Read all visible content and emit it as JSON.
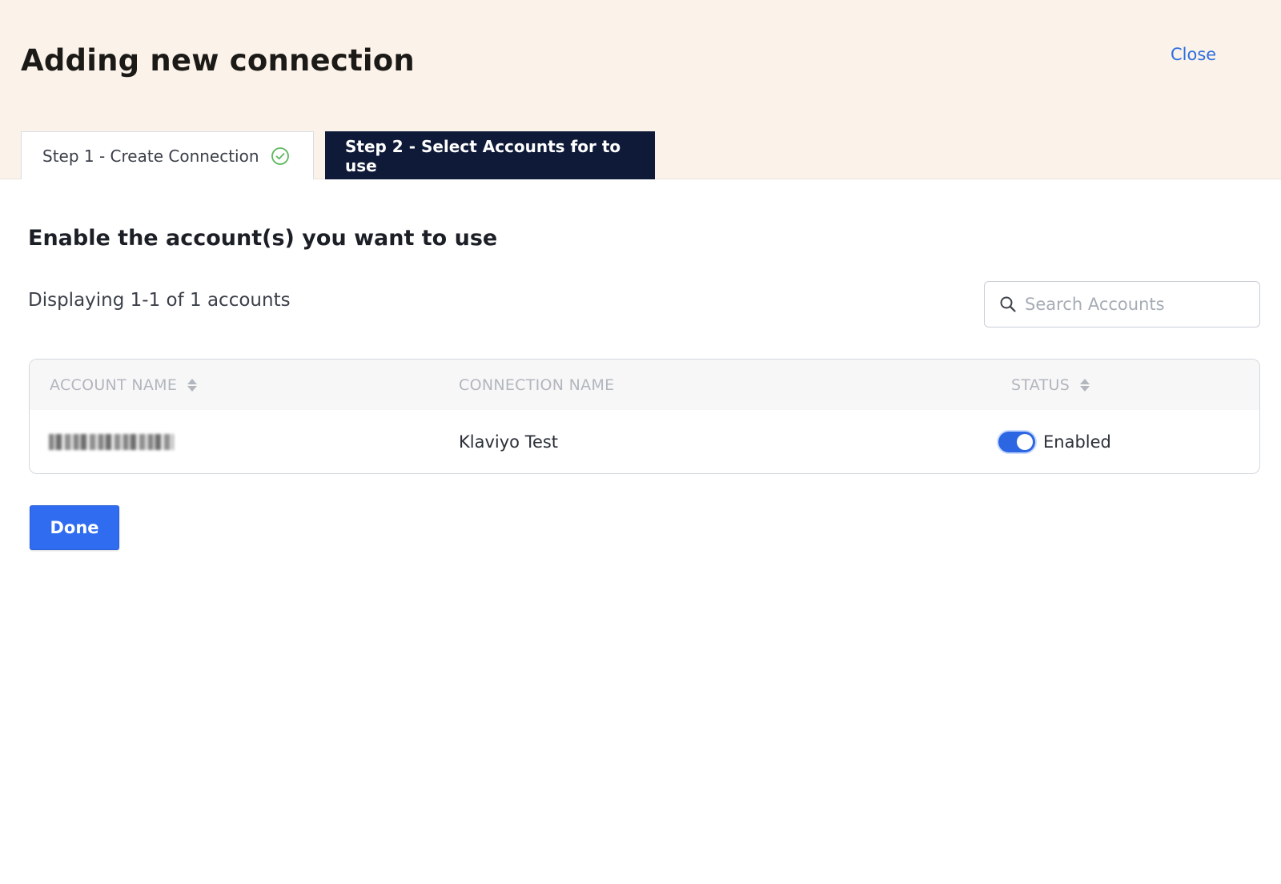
{
  "header": {
    "title": "Adding new connection",
    "close_label": "Close"
  },
  "steps": [
    {
      "label": "Step 1 - Create Connection",
      "completed": true
    },
    {
      "label": "Step 2 - Select Accounts for to use",
      "active": true
    }
  ],
  "main": {
    "heading": "Enable the account(s) you want to use",
    "display_count": "Displaying 1-1 of 1 accounts",
    "search": {
      "placeholder": "Search Accounts",
      "value": ""
    }
  },
  "table": {
    "columns": [
      "ACCOUNT NAME",
      "CONNECTION NAME",
      "STATUS"
    ],
    "rows": [
      {
        "account_name_blurred": true,
        "connection_name": "Klaviyo Test",
        "status": "Enabled",
        "enabled": true
      }
    ]
  },
  "actions": {
    "done_label": "Done"
  },
  "colors": {
    "header_bg": "#fbf2e9",
    "active_tab_bg": "#0e1a38",
    "primary": "#2f6cf0",
    "link": "#2f6fe0",
    "success": "#5cb85c"
  }
}
